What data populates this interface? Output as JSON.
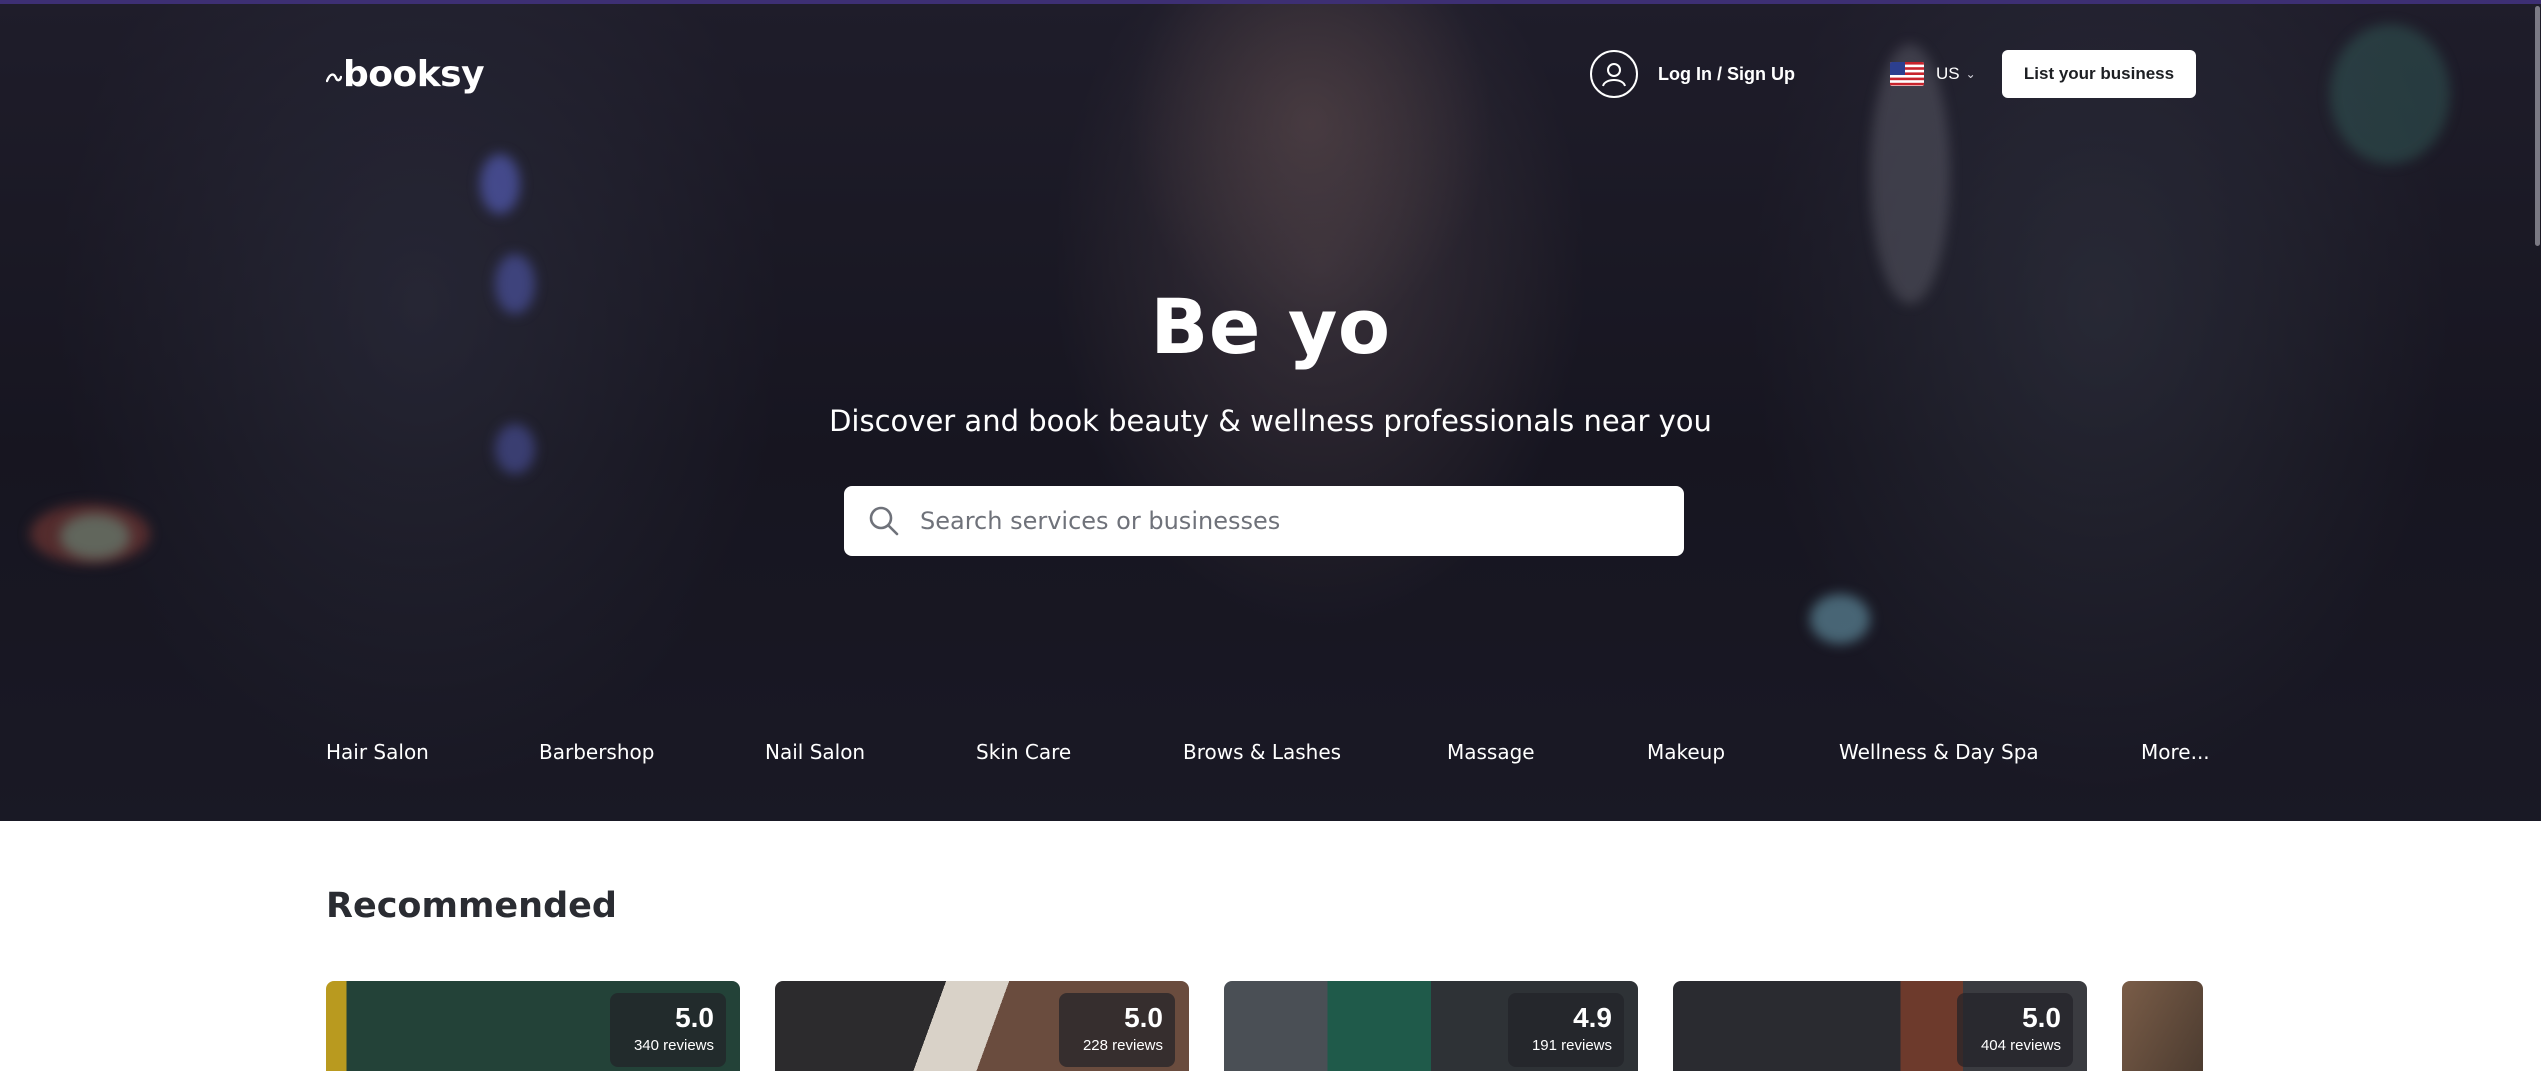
{
  "header": {
    "logo_text": "booksy",
    "login_label": "Log In / Sign Up",
    "country_code": "US",
    "list_business_label": "List your business"
  },
  "hero": {
    "headline": "Be yo",
    "subheadline": "Discover and book beauty & wellness professionals near you",
    "search_placeholder": "Search services or businesses"
  },
  "categories": [
    "Hair Salon",
    "Barbershop",
    "Nail Salon",
    "Skin Care",
    "Brows & Lashes",
    "Massage",
    "Makeup",
    "Wellness & Day Spa",
    "More..."
  ],
  "recommended": {
    "title": "Recommended",
    "cards": [
      {
        "score": "5.0",
        "reviews": "340 reviews",
        "accent": "#1f3b35"
      },
      {
        "score": "5.0",
        "reviews": "228 reviews",
        "accent": "#3a3633"
      },
      {
        "score": "4.9",
        "reviews": "191 reviews",
        "accent": "#3b3f44"
      },
      {
        "score": "5.0",
        "reviews": "404 reviews",
        "accent": "#2a2b30"
      },
      {
        "score": "",
        "reviews": "",
        "accent": "#5a4638"
      }
    ]
  },
  "colors": {
    "brand_top_bar": "#3d2f73",
    "hero_overlay": "#1f1d29",
    "card_badge": "#232328"
  },
  "icons": {
    "logo": "booksy-swoosh-icon",
    "user": "user-circle-icon",
    "flag": "us-flag-icon",
    "chevron": "chevron-down-icon",
    "search": "search-icon"
  }
}
